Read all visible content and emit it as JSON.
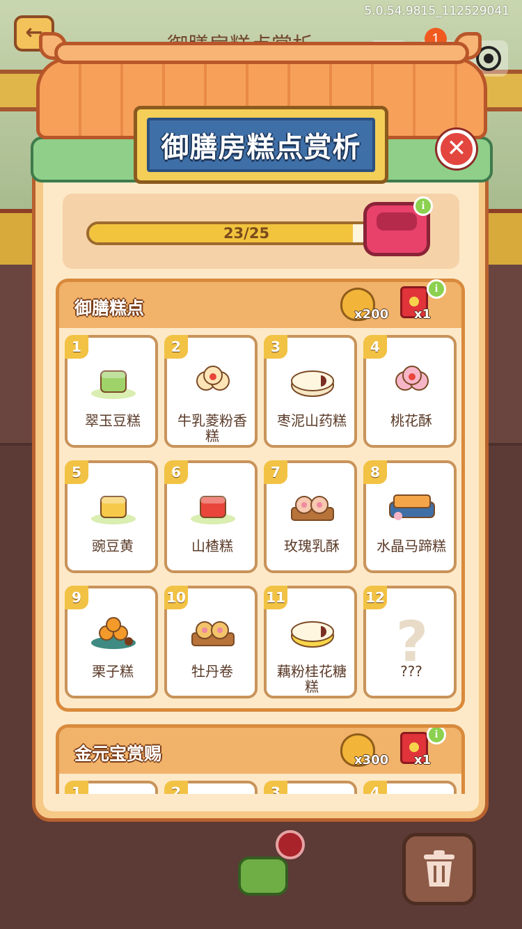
{
  "system": {
    "version": "5.0.54.9815_112529041",
    "notification_count": "1"
  },
  "background": {
    "back_icon": "arrow-left-icon",
    "title": "御膳房糕点赏析"
  },
  "dialog": {
    "title": "御膳房糕点赏析",
    "close_icon": "close-icon"
  },
  "progress": {
    "current": 23,
    "total": 25,
    "label": "23/25",
    "fraction": 0.92,
    "reward_icon": "treasure-chest-icon",
    "info_label": "i"
  },
  "sections": [
    {
      "title": "御膳糕点",
      "reward_gold": "x200",
      "reward_envelope": "x1",
      "info_label": "i",
      "items": [
        {
          "num": "1",
          "name": "翠玉豆糕",
          "color": "#9fd36a",
          "shape": "cube"
        },
        {
          "num": "2",
          "name": "牛乳菱粉香糕",
          "color": "#fde5b8",
          "shape": "flower"
        },
        {
          "num": "3",
          "name": "枣泥山药糕",
          "color": "#f6e6c4",
          "shape": "pie"
        },
        {
          "num": "4",
          "name": "桃花酥",
          "color": "#f7b6c8",
          "shape": "flower"
        },
        {
          "num": "5",
          "name": "豌豆黄",
          "color": "#f6c94a",
          "shape": "cube"
        },
        {
          "num": "6",
          "name": "山楂糕",
          "color": "#e9453a",
          "shape": "cube"
        },
        {
          "num": "7",
          "name": "玫瑰乳酥",
          "color": "#f7c9b0",
          "shape": "roll"
        },
        {
          "num": "8",
          "name": "水晶马蹄糕",
          "color": "#f4a54a",
          "shape": "bar"
        },
        {
          "num": "9",
          "name": "栗子糕",
          "color": "#f39a2a",
          "shape": "ball"
        },
        {
          "num": "10",
          "name": "牡丹卷",
          "color": "#f3c46a",
          "shape": "roll"
        },
        {
          "num": "11",
          "name": "藕粉桂花糖糕",
          "color": "#f8d64a",
          "shape": "pie"
        },
        {
          "num": "12",
          "name": "???",
          "color": "#e8dcc8",
          "shape": "unknown"
        }
      ]
    },
    {
      "title": "金元宝赏赐",
      "reward_gold": "x300",
      "reward_envelope": "x1",
      "info_label": "i",
      "items": [
        {
          "num": "1"
        },
        {
          "num": "2"
        },
        {
          "num": "3"
        },
        {
          "num": "4"
        }
      ]
    }
  ],
  "bottom": {
    "trash_icon": "trash-icon"
  }
}
